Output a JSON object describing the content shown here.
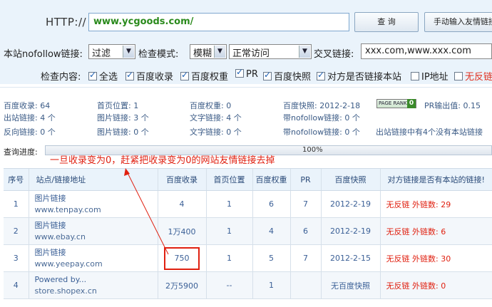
{
  "header": {
    "http_label": "HTTP://",
    "url_value": "www.ycgoods.com/",
    "query_button": "查 询",
    "manual_button": "手动输入友情链接"
  },
  "options": {
    "nofollow_label": "本站nofollow链接:",
    "nofollow_value": "过滤",
    "mode_label": "检查模式:",
    "mode_value": "模糊",
    "access_value": "正常访问",
    "cross_label": "交叉链接:",
    "cross_value": "xxx.com,www.xxx.com"
  },
  "checks": {
    "label": "检查内容:",
    "items": [
      {
        "label": "全选",
        "checked": true
      },
      {
        "label": "百度收录",
        "checked": true
      },
      {
        "label": "百度权重",
        "checked": true
      },
      {
        "label": "PR",
        "checked": true
      },
      {
        "label": "百度快照",
        "checked": true
      },
      {
        "label": "对方是否链接本站",
        "checked": true
      },
      {
        "label": "IP地址",
        "checked": false
      },
      {
        "label": "无反链",
        "checked": false
      }
    ]
  },
  "stats": {
    "baidu_index": "百度收录:  64",
    "home_pos": "首页位置:  1",
    "baidu_weight": "百度权重:  0",
    "baidu_snapshot": "百度快照:  2012-2-18",
    "pr_badge_text": "PAGE RANK",
    "pr_badge_num": "0",
    "pr_output": "PR输出值: 0.15",
    "out_links": "出站链接:  4 个",
    "img_links": "图片链接:  3 个",
    "text_links": "文字链接:  4 个",
    "with_nofollow": "带nofollow链接:  0 个",
    "reverse_links": "反向链接:  0 个",
    "img_links2": "图片链接:  0 个",
    "text_links2": "文字链接:  0 个",
    "with_nofollow2": "带nofollow链接:  0 个",
    "note": "出站链接中有4个没有本站链接"
  },
  "progress": {
    "label": "查询进度:",
    "percent_text": "100%",
    "fraction": 1.0
  },
  "annotation": "一旦收录变为0，赶紧把收录变为0的网站友情链接去掉",
  "table": {
    "headers": [
      "序号",
      "站点/链接地址",
      "百度收录",
      "首页位置",
      "百度权重",
      "PR",
      "百度快照",
      "对方链接是否有本站的链接!"
    ],
    "rows": [
      {
        "no": "1",
        "name": "图片链接",
        "url": "www.tenpay.com",
        "index": "4",
        "home": "1",
        "weight": "6",
        "pr": "7",
        "snap": "2012-2-19",
        "link": "无反链  外链数: 29"
      },
      {
        "no": "2",
        "name": "图片链接",
        "url": "www.ebay.cn",
        "index": "1万400",
        "home": "1",
        "weight": "4",
        "pr": "6",
        "snap": "2012-2-19",
        "link": "无反链  外链数: 6"
      },
      {
        "no": "3",
        "name": "图片链接",
        "url": "www.yeepay.com",
        "index": "750",
        "home": "1",
        "weight": "5",
        "pr": "7",
        "snap": "2012-2-15",
        "link": "无反链  外链数: 30"
      },
      {
        "no": "4",
        "name": "Powered by...",
        "url": "store.shopex.cn",
        "index": "2万5900",
        "home": "--",
        "weight": "1",
        "pr": "",
        "snap": "无百度快照",
        "link": "无反链  外链数: 0"
      }
    ]
  },
  "colors": {
    "accent_red": "#e02010",
    "link_blue": "#3a5f96",
    "url_green": "#2a8a1c",
    "header_bg": "#eaf3fb"
  }
}
